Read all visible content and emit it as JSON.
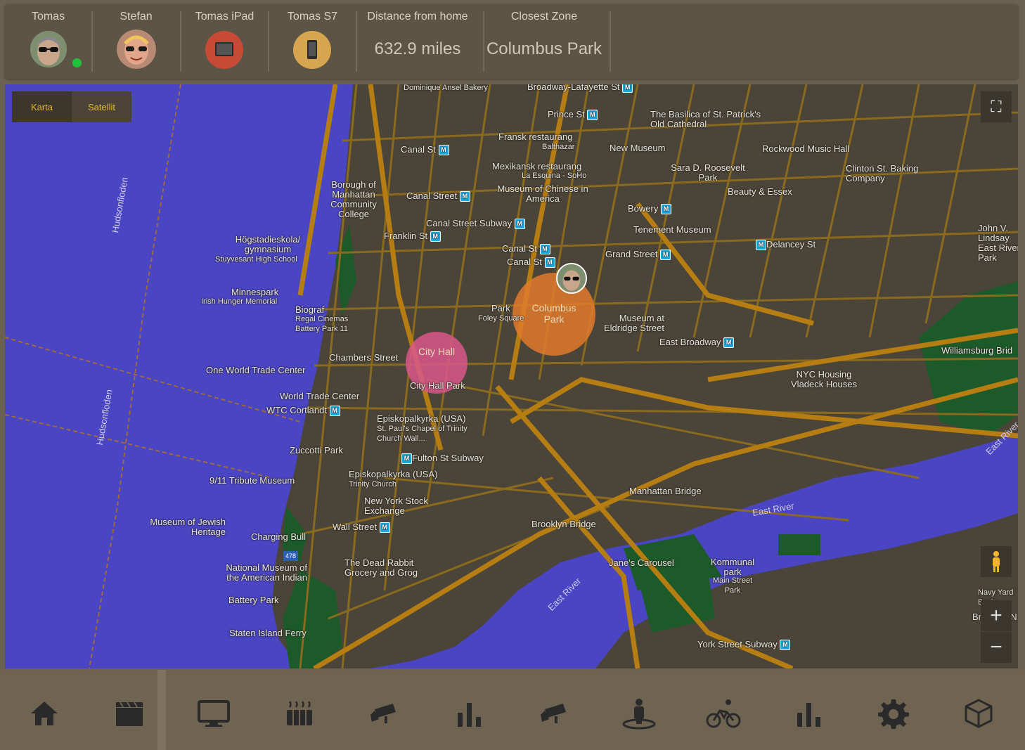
{
  "people": [
    {
      "name": "Tomas",
      "status": "home",
      "status_color": "#20c23a"
    },
    {
      "name": "Stefan"
    },
    {
      "name": "Tomas iPad",
      "icon": "tablet-icon",
      "color": "#c74a37"
    },
    {
      "name": "Tomas S7",
      "icon": "phone-icon",
      "color": "#d6a550"
    }
  ],
  "distance": {
    "label": "Distance from home",
    "value": "632.9 miles"
  },
  "zone": {
    "label": "Closest Zone",
    "value": "Columbus Park"
  },
  "map": {
    "type_buttons": [
      {
        "label": "Karta",
        "active": true
      },
      {
        "label": "Satellit",
        "active": false
      }
    ],
    "zones": [
      {
        "name": "City Hall",
        "color": "#d9578a"
      },
      {
        "name": "Columbus Park",
        "color": "#e07a2c"
      }
    ],
    "labels": {
      "dominique": "Dominique Ansel Bakery",
      "broadway_lafayette": "Broadway-Lafayette St",
      "prince": "Prince St",
      "basilica": "The Basilica of St. Patrick's Old Cathedral",
      "fransk": "Fransk restaurang",
      "balthazar": "Balthazar",
      "new_museum": "New Museum",
      "rockwood": "Rockwood Music Hall",
      "canal_st_1": "Canal St",
      "mexikansk": "Mexikansk restaurang",
      "la_esquina": "La Esquina - SoHo",
      "sara_d": "Sara D. Roosevelt Park",
      "clinton": "Clinton St. Baking Company",
      "borough": "Borough of Manhattan Community College",
      "canal_street": "Canal Street",
      "museum_chinese": "Museum of Chinese in America",
      "beauty": "Beauty & Essex",
      "bowery": "Bowery",
      "hogstadie": "Högstadieskola/ gymnasium",
      "stuyvesant": "Stuyvesant High School",
      "canal_subway": "Canal Street Subway",
      "franklin": "Franklin St",
      "tenement": "Tenement Museum",
      "john_v": "John V. Lindsay East River Park",
      "delancey": "Delancey St",
      "canal_st_2": "Canal St",
      "canal_st_3": "Canal St",
      "grand_street": "Grand Street",
      "minnespark": "Minnespark",
      "irish_hunger": "Irish Hunger Memorial",
      "biograf": "Biograf",
      "regal": "Regal Cinemas Battery Park 11",
      "park": "Park",
      "foley": "Foley Square",
      "eldridge": "Museum at Eldridge Street",
      "east_broadway": "East Broadway",
      "williamsburg_brid": "Williamsburg Brid",
      "chambers": "Chambers Street",
      "city_hall_park": "City Hall Park",
      "one_wtc": "One World Trade Center",
      "nyc_housing": "NYC Housing Vladeck Houses",
      "wtc": "World Trade Center",
      "wtc_cortlandt": "WTC Cortlandt",
      "episkopal1": "Episkopalkyrka (USA)",
      "st_pauls": "St. Paul's Chapel of Trinity Church Wall...",
      "zuccotti": "Zuccotti Park",
      "fulton": "Fulton St Subway",
      "tribute": "9/11 Tribute Museum",
      "episkopal2": "Episkopalkyrka (USA)",
      "trinity": "Trinity Church",
      "manhattan_bridge": "Manhattan Bridge",
      "nyse": "New York Stock Exchange",
      "jewish": "Museum of Jewish Heritage",
      "wall_street": "Wall Street",
      "brooklyn_bridge": "Brooklyn Bridge",
      "charging_bull": "Charging Bull",
      "dead_rabbit": "The Dead Rabbit Grocery and Grog",
      "janes": "Jane's Carousel",
      "kommunal": "Kommunal park",
      "main_street": "Main Street Park",
      "american_indian": "National Museum of the American Indian",
      "battery": "Battery Park",
      "staten": "Staten Island Ferry",
      "york_street": "York Street Subway",
      "navy_yard": "Navy Yard Basin",
      "brooklyn_n": "Brooklyn N",
      "hudson1": "Hudsonfloden",
      "hudson2": "Hudsonfloden",
      "east_river1": "East River",
      "east_river2": "East River",
      "east_river3": "East River",
      "interstate": "478"
    }
  },
  "nav": [
    {
      "icon": "home-icon"
    },
    {
      "icon": "clapperboard-icon"
    },
    {
      "icon": "monitor-icon"
    },
    {
      "icon": "radiator-icon"
    },
    {
      "icon": "security-camera-icon"
    },
    {
      "icon": "bar-chart-icon"
    },
    {
      "icon": "security-camera-icon"
    },
    {
      "icon": "person-location-icon"
    },
    {
      "icon": "bicycle-icon"
    },
    {
      "icon": "bar-chart-icon"
    },
    {
      "icon": "gear-icon"
    },
    {
      "icon": "cube-icon"
    }
  ]
}
